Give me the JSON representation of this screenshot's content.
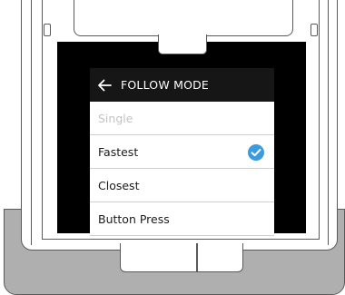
{
  "screen": {
    "title": "FOLLOW MODE",
    "back_icon": "arrow-left-icon",
    "options": [
      {
        "label": "Single",
        "state": "disabled"
      },
      {
        "label": "Fastest",
        "state": "selected"
      },
      {
        "label": "Closest",
        "state": "normal"
      },
      {
        "label": "Button Press",
        "state": "normal"
      }
    ],
    "selected_icon": "checkmark-circle-icon",
    "accent_color": "#3a9be0",
    "header_color": "#161616"
  }
}
